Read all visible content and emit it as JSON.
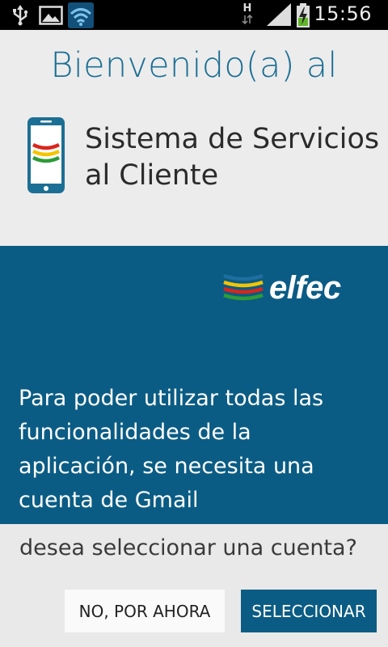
{
  "status_bar": {
    "time": "15:56",
    "network_label": "H",
    "icons": [
      "usb-icon",
      "image-notification-icon",
      "wifi-icon",
      "network-h-icon",
      "signal-icon",
      "battery-charging-icon"
    ]
  },
  "welcome": {
    "title": "Bienvenido(a) al",
    "app_name_line1": "Sistema de Servicios",
    "app_name_line2": "al Cliente"
  },
  "brand": {
    "logo_text": "elfec",
    "stripe_colors": [
      "#1e6fa0",
      "#f4c400",
      "#d9261c",
      "#2e9b38"
    ]
  },
  "message": {
    "body": "Para poder utilizar todas las funcionalidades de la aplicación, se necesita una cuenta de Gmail",
    "question": "desea seleccionar una cuenta?"
  },
  "actions": {
    "decline_label": "NO, POR AHORA",
    "select_label": "SELECCIONAR"
  },
  "colors": {
    "primary": "#0b5c84",
    "title": "#1c6f94",
    "background": "#ececec"
  }
}
